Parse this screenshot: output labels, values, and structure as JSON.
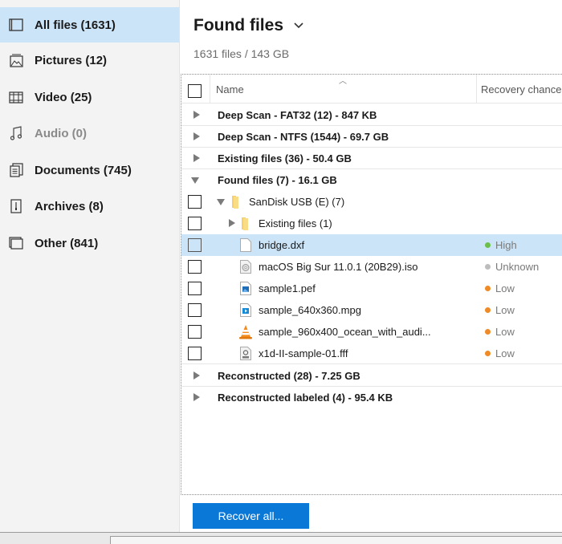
{
  "sidebar": {
    "items": [
      {
        "label": "All files (1631)",
        "icon": "all-files-icon",
        "active": true
      },
      {
        "label": "Pictures (12)",
        "icon": "pictures-icon"
      },
      {
        "label": "Video (25)",
        "icon": "video-icon"
      },
      {
        "label": "Audio (0)",
        "icon": "audio-icon",
        "disabled": true
      },
      {
        "label": "Documents (745)",
        "icon": "documents-icon"
      },
      {
        "label": "Archives (8)",
        "icon": "archives-icon"
      },
      {
        "label": "Other (841)",
        "icon": "other-icon"
      }
    ]
  },
  "header": {
    "title": "Found files",
    "summary": "1631 files / 143 GB"
  },
  "table": {
    "columns": {
      "name": "Name",
      "recovery": "Recovery chances"
    },
    "groups": {
      "deep_fat32": "Deep Scan - FAT32 (12) - 847 KB",
      "deep_ntfs": "Deep Scan - NTFS (1544) - 69.7 GB",
      "existing": "Existing files (36) - 50.4 GB",
      "found": "Found files (7) - 16.1 GB",
      "reconstructed": "Reconstructed (28) - 7.25 GB",
      "reconstructed_labeled": "Reconstructed labeled (4) - 95.4 KB"
    },
    "folders": {
      "sandisk": "SanDisk USB (E) (7)",
      "existing_sub": "Existing files (1)"
    },
    "files": [
      {
        "name": "bridge.dxf",
        "icon": "blank-file-icon",
        "chance": "High",
        "chance_color": "#6cc04a",
        "selected": true
      },
      {
        "name": "macOS Big Sur 11.0.1 (20B29).iso",
        "icon": "disc-image-icon",
        "chance": "Unknown",
        "chance_color": "#bdbdbd"
      },
      {
        "name": "sample1.pef",
        "icon": "image-file-icon",
        "chance": "Low",
        "chance_color": "#f08a24"
      },
      {
        "name": "sample_640x360.mpg",
        "icon": "video-file-icon",
        "chance": "Low",
        "chance_color": "#f08a24"
      },
      {
        "name": "sample_960x400_ocean_with_audi...",
        "icon": "vlc-cone-icon",
        "chance": "Low",
        "chance_color": "#f08a24"
      },
      {
        "name": "x1d-II-sample-01.fff",
        "icon": "raw-file-icon",
        "chance": "Low",
        "chance_color": "#f08a24"
      }
    ]
  },
  "actions": {
    "recover_all": "Recover all..."
  }
}
